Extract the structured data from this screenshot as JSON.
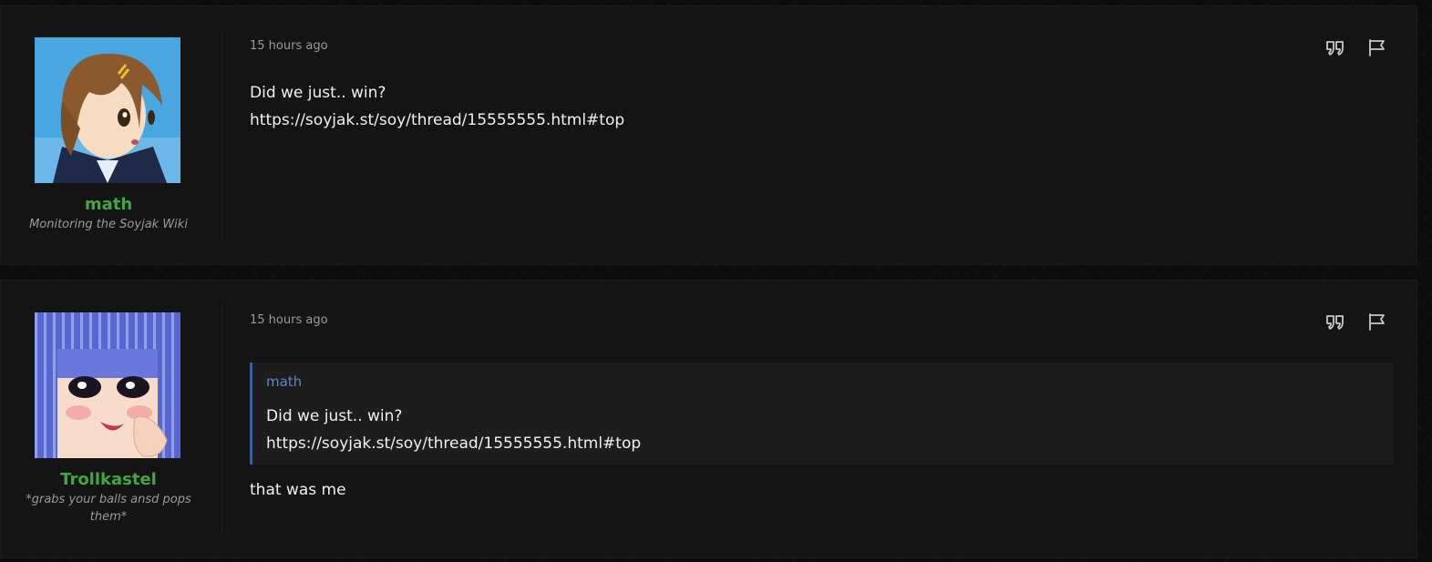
{
  "posts": [
    {
      "username": "math",
      "user_title": "Monitoring the Soyjak Wiki",
      "timestamp": "15 hours ago",
      "body_lines": [
        "Did we just.. win?",
        "https://soyjak.st/soy/thread/15555555.html#top"
      ],
      "actions": {
        "quote_icon": "quote-icon",
        "report_icon": "flag-icon"
      }
    },
    {
      "username": "Trollkastel",
      "user_title": "*grabs your balls ansd pops them*",
      "timestamp": "15 hours ago",
      "quote": {
        "author": "math",
        "lines": [
          "Did we just.. win?",
          "https://soyjak.st/soy/thread/15555555.html#top"
        ]
      },
      "reply_text": "that was me",
      "actions": {
        "quote_icon": "quote-icon",
        "report_icon": "flag-icon"
      }
    }
  ],
  "colors": {
    "username": "#3ea83e",
    "quote_accent": "#3e5f9a",
    "quote_author": "#5f86c6",
    "post_background": "#141414"
  }
}
